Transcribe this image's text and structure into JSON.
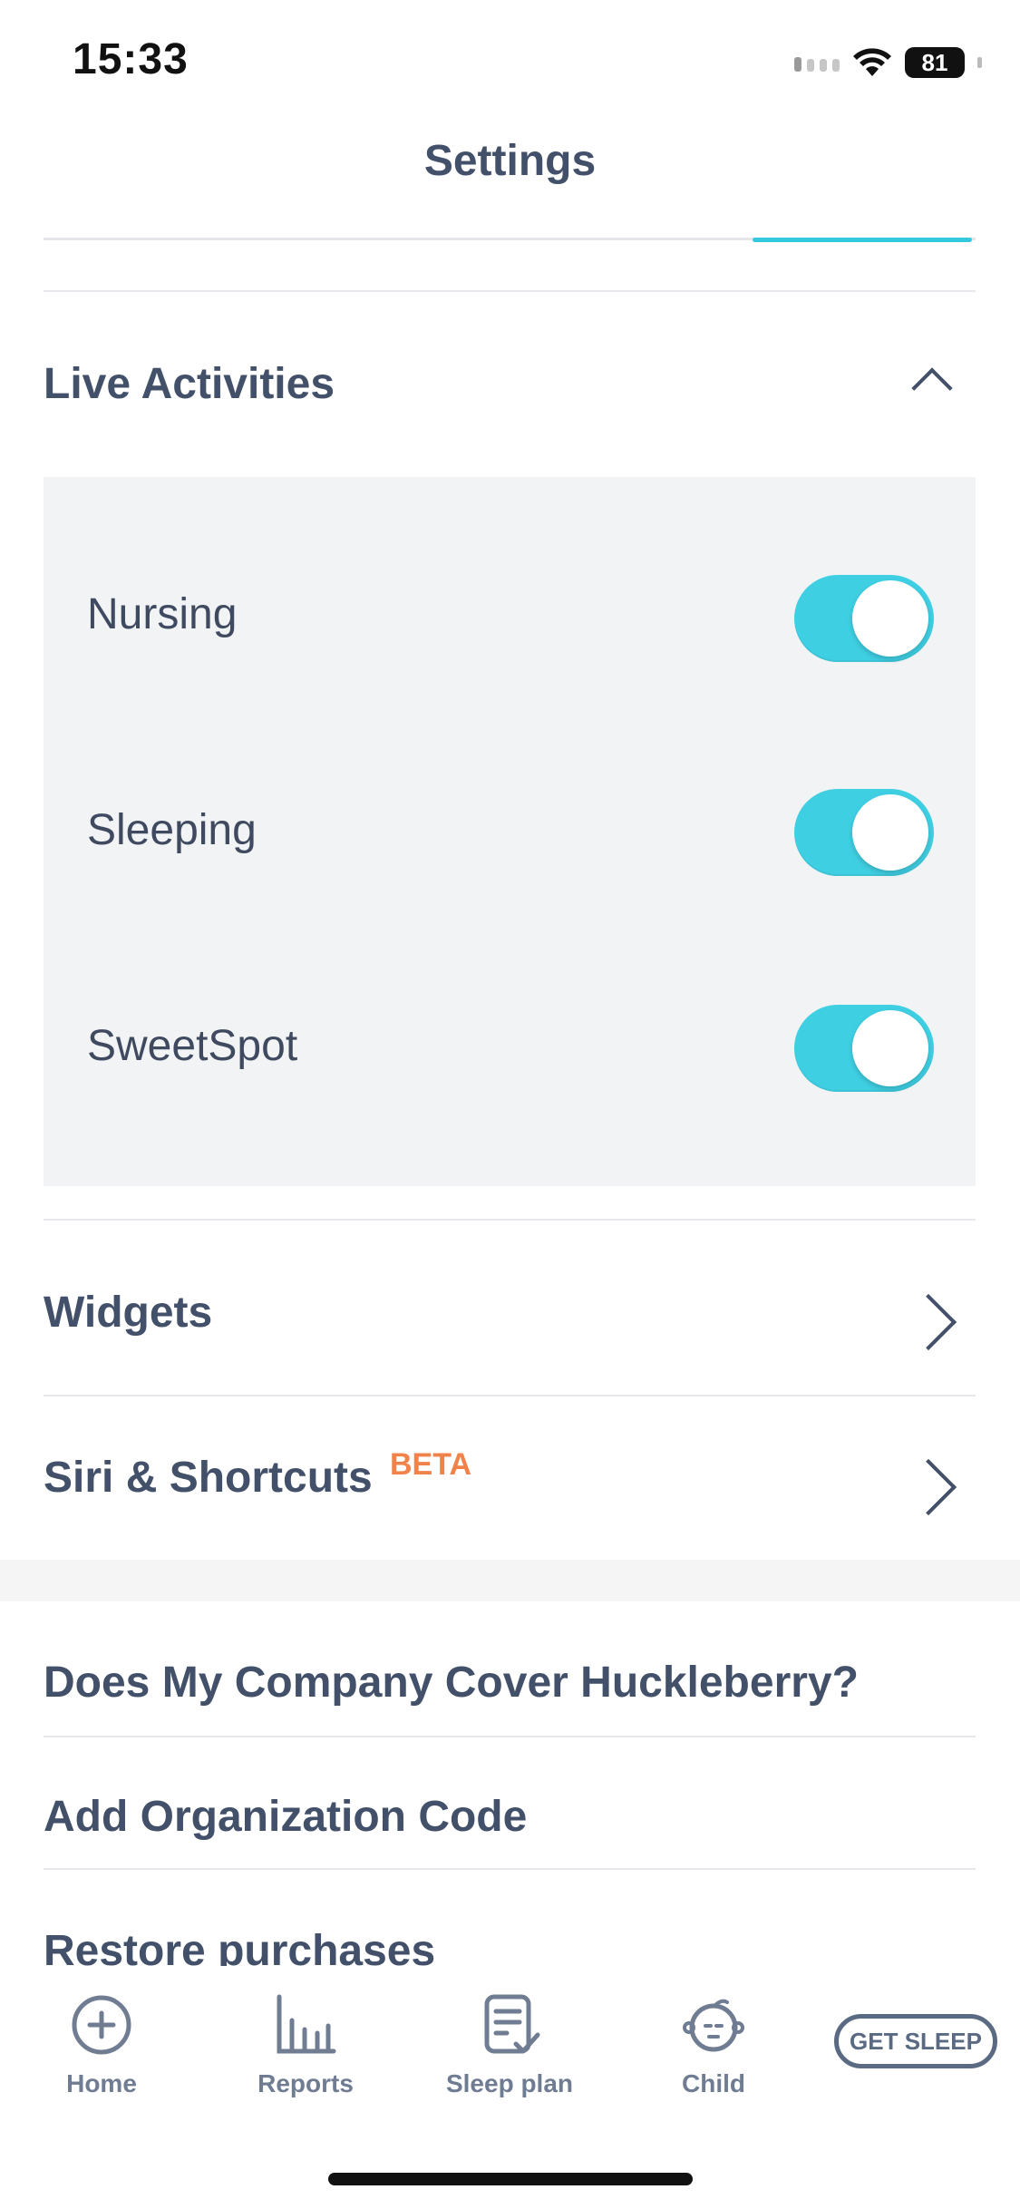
{
  "status_bar": {
    "time": "15:33",
    "battery": "81"
  },
  "header": {
    "title": "Settings"
  },
  "live_activities": {
    "title": "Live Activities",
    "items": [
      {
        "label": "Nursing",
        "enabled": true
      },
      {
        "label": "Sleeping",
        "enabled": true
      },
      {
        "label": "SweetSpot",
        "enabled": true
      }
    ]
  },
  "widgets": {
    "label": "Widgets"
  },
  "siri": {
    "label": "Siri & Shortcuts",
    "badge": "BETA"
  },
  "more_rows": {
    "company": "Does My Company Cover Huckleberry?",
    "org_code": "Add Organization Code",
    "restore": "Restore purchases"
  },
  "tabbar": {
    "tabs": [
      {
        "label": "Home",
        "icon": "plus-circle-icon"
      },
      {
        "label": "Reports",
        "icon": "bar-chart-icon"
      },
      {
        "label": "Sleep plan",
        "icon": "clipboard-check-icon"
      },
      {
        "label": "Child",
        "icon": "baby-face-icon"
      }
    ],
    "get_sleep": "GET SLEEP"
  },
  "colors": {
    "accent": "#3fcfe3",
    "text": "#435069",
    "beta": "#f0824a",
    "panel": "#f1f3f4"
  }
}
